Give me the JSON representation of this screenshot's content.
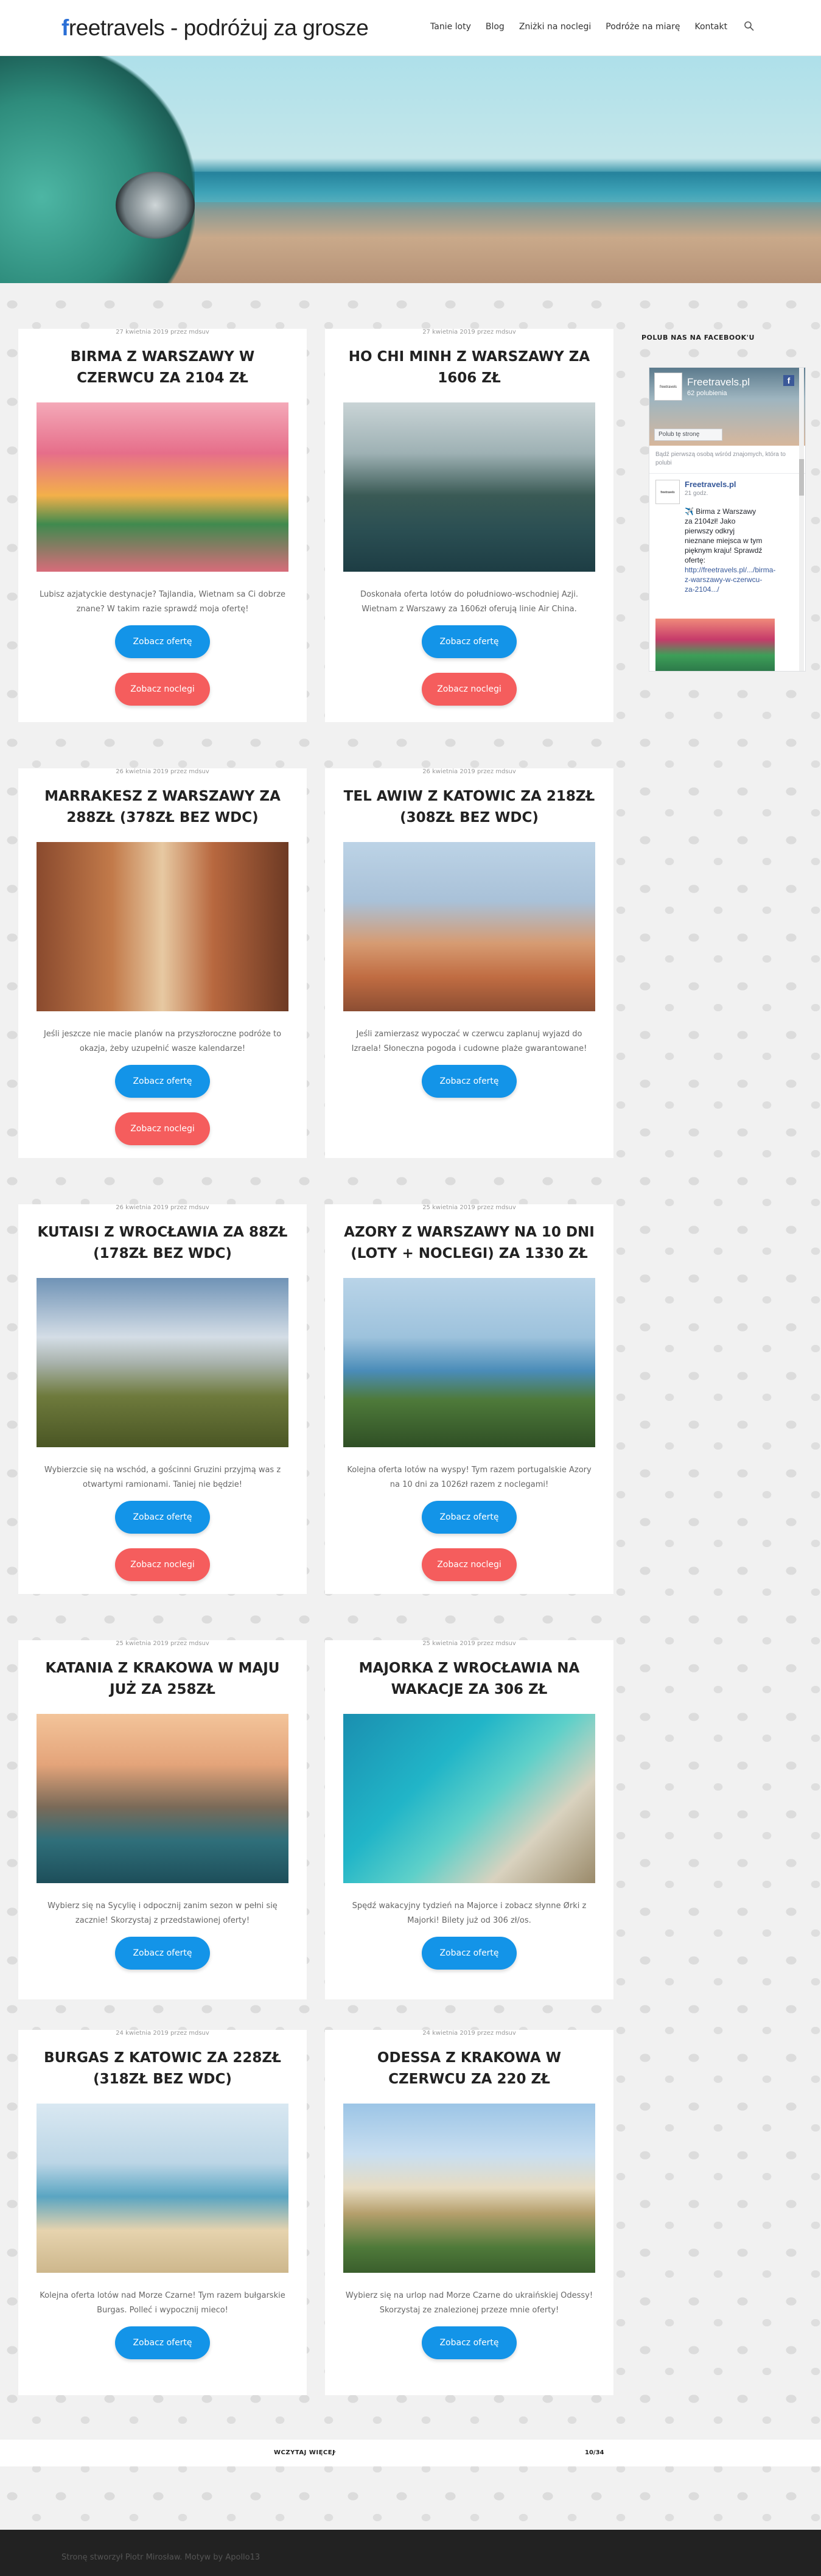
{
  "header": {
    "logo_first": "f",
    "logo_rest": "reetravels - podróżuj za grosze",
    "nav": [
      "Tanie loty",
      "Blog",
      "Zniżki na noclegi",
      "Podróże na miarę",
      "Kontakt"
    ]
  },
  "posts": [
    {
      "meta": "27 kwietnia 2019 przez mdsuv",
      "title": "BIRMA Z WARSZAWY W CZERWCU ZA 2104 ZŁ",
      "text": "Lubisz azjatyckie destynacje? Tajlandia, Wietnam sa Ci dobrze znane? W takim razie sprawdź moja ofertę!",
      "btn_offer": "Zobacz ofertę",
      "btn_stay": "Zobacz noclegi"
    },
    {
      "meta": "27 kwietnia 2019 przez mdsuv",
      "title": "HO CHI MINH Z WARSZAWY ZA 1606 ZŁ",
      "text": "Doskonała oferta lotów do południowo-wschodniej Azji. Wietnam z Warszawy za 1606zł oferują linie Air China.",
      "btn_offer": "Zobacz ofertę",
      "btn_stay": "Zobacz noclegi"
    },
    {
      "meta": "26 kwietnia 2019 przez mdsuv",
      "title": "MARRAKESZ Z WARSZAWY ZA 288ZŁ (378ZŁ BEZ WDC)",
      "text": "Jeśli jeszcze nie macie planów na przyszłoroczne podróże to okazja, żeby uzupełnić wasze kalendarze!",
      "btn_offer": "Zobacz ofertę",
      "btn_stay": "Zobacz noclegi"
    },
    {
      "meta": "26 kwietnia 2019 przez mdsuv",
      "title": "TEL AWIW Z KATOWIC ZA 218ZŁ (308ZŁ BEZ WDC)",
      "text": "Jeśli zamierzasz wypoczać w czerwcu zaplanuj wyjazd do Izraela! Słoneczna pogoda i cudowne plaże gwarantowane!",
      "btn_offer": "Zobacz ofertę"
    },
    {
      "meta": "26 kwietnia 2019 przez mdsuv",
      "title": "KUTAISI Z WROCŁAWIA ZA 88ZŁ (178ZŁ BEZ WDC)",
      "text": "Wybierzcie się na wschód, a gościnni Gruzini przyjmą was z otwartymi ramionami. Taniej nie będzie!",
      "btn_offer": "Zobacz ofertę",
      "btn_stay": "Zobacz noclegi"
    },
    {
      "meta": "25 kwietnia 2019 przez mdsuv",
      "title": "AZORY Z WARSZAWY NA 10 DNI (LOTY + NOCLEGI) ZA 1330 ZŁ",
      "text": "Kolejna oferta lotów na wyspy! Tym razem portugalskie Azory na 10 dni za 1026zł razem z noclegami!",
      "btn_offer": "Zobacz ofertę",
      "btn_stay": "Zobacz noclegi"
    },
    {
      "meta": "25 kwietnia 2019 przez mdsuv",
      "title": "KATANIA Z KRAKOWA W MAJU JUŻ ZA 258ZŁ",
      "text": "Wybierz się na Sycylię i odpocznij zanim sezon w pełni się zacznie! Skorzystaj z przedstawionej oferty!",
      "btn_offer": "Zobacz ofertę"
    },
    {
      "meta": "25 kwietnia 2019 przez mdsuv",
      "title": "MAJORKA Z WROCŁAWIA NA WAKACJE ZA 306 ZŁ",
      "text": "Spędź wakacyjny tydzień na Majorce i zobacz słynne Ørki z Majorki! Bilety już od 306 zł/os.",
      "btn_offer": "Zobacz ofertę"
    },
    {
      "meta": "24 kwietnia 2019 przez mdsuv",
      "title": "BURGAS Z KATOWIC ZA 228ZŁ (318ZŁ BEZ WDC)",
      "text": "Kolejna oferta lotów nad Morze Czarne! Tym razem bułgarskie Burgas. Polleć i wypocznij mieco!",
      "btn_offer": "Zobacz ofertę"
    },
    {
      "meta": "24 kwietnia 2019 przez mdsuv",
      "title": "ODESSA Z KRAKOWA W CZERWCU ZA 220 ZŁ",
      "text": "Wybierz się na urlop nad Morze Czarne do ukraińskiej Odessy! Skorzystaj ze znalezionej przeze mnie oferty!",
      "btn_offer": "Zobacz ofertę"
    }
  ],
  "sidebar": {
    "title": "POLUB NAS NA FACEBOOK'U",
    "page_name": "Freetravels.pl",
    "page_likes": "62 polubienia",
    "like_btn": "Polub tę stronę",
    "friends_text": "Bądź pierwszą osobą wśród znajomych, która to polubi",
    "post_title": "Freetravels.pl",
    "post_time": "21 godz.",
    "post_text": "✈️ Birma z Warszawy za 2104zł! Jako pierwszy odkryj nieznane miejsca w tym pięknym kraju! Sprawdź ofertę:",
    "post_link": "http://freetravels.pl/.../birma-z-warszawy-w-czerwcu-za-2104.../"
  },
  "loadmore": {
    "label": "WCZYTAJ WIĘCEJ",
    "count": "10/34"
  },
  "footer": {
    "text": "Stronę stworzył Piotr Mirosław. Motyw by Apollo13"
  }
}
